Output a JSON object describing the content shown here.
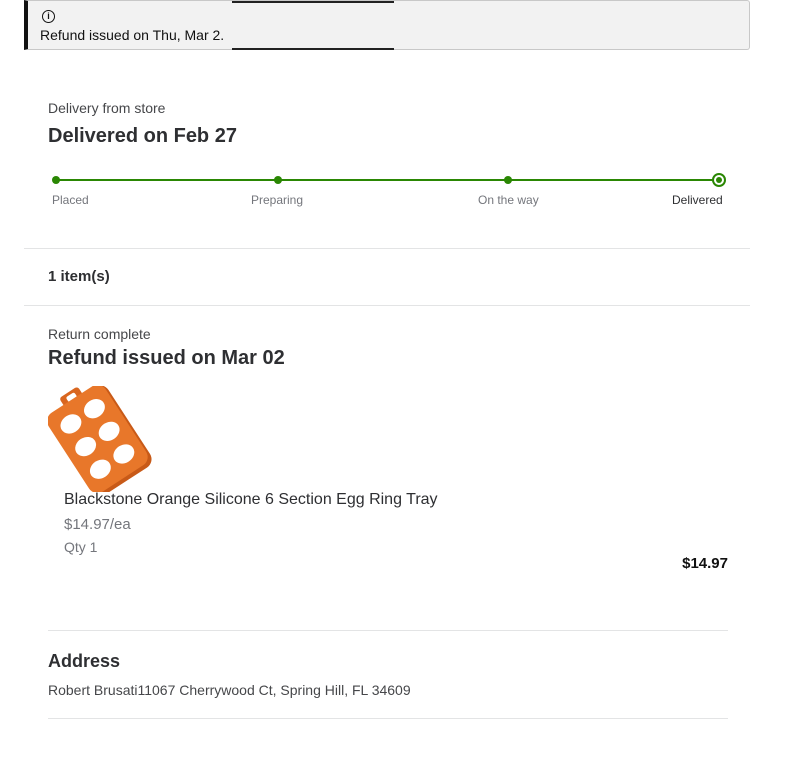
{
  "banner": {
    "icon": "info-icon",
    "message": "Refund issued on Thu, Mar 2."
  },
  "delivery": {
    "source": "Delivery from store",
    "status_title": "Delivered on Feb 27",
    "steps": [
      {
        "label": "Placed",
        "state": "complete"
      },
      {
        "label": "Preparing",
        "state": "complete"
      },
      {
        "label": "On the way",
        "state": "complete"
      },
      {
        "label": "Delivered",
        "state": "current"
      }
    ],
    "progress_color": "#2a8703"
  },
  "items_count": "1 item(s)",
  "return": {
    "status": "Return complete",
    "title": "Refund issued on Mar 02"
  },
  "product": {
    "name": "Blackstone Orange Silicone 6 Section Egg Ring Tray",
    "unit_price": "$14.97/ea",
    "qty": "Qty 1",
    "total": "$14.97",
    "image_color": "#e8772a"
  },
  "address": {
    "title": "Address",
    "text": "Robert Brusati11067 Cherrywood Ct, Spring Hill, FL 34609"
  }
}
